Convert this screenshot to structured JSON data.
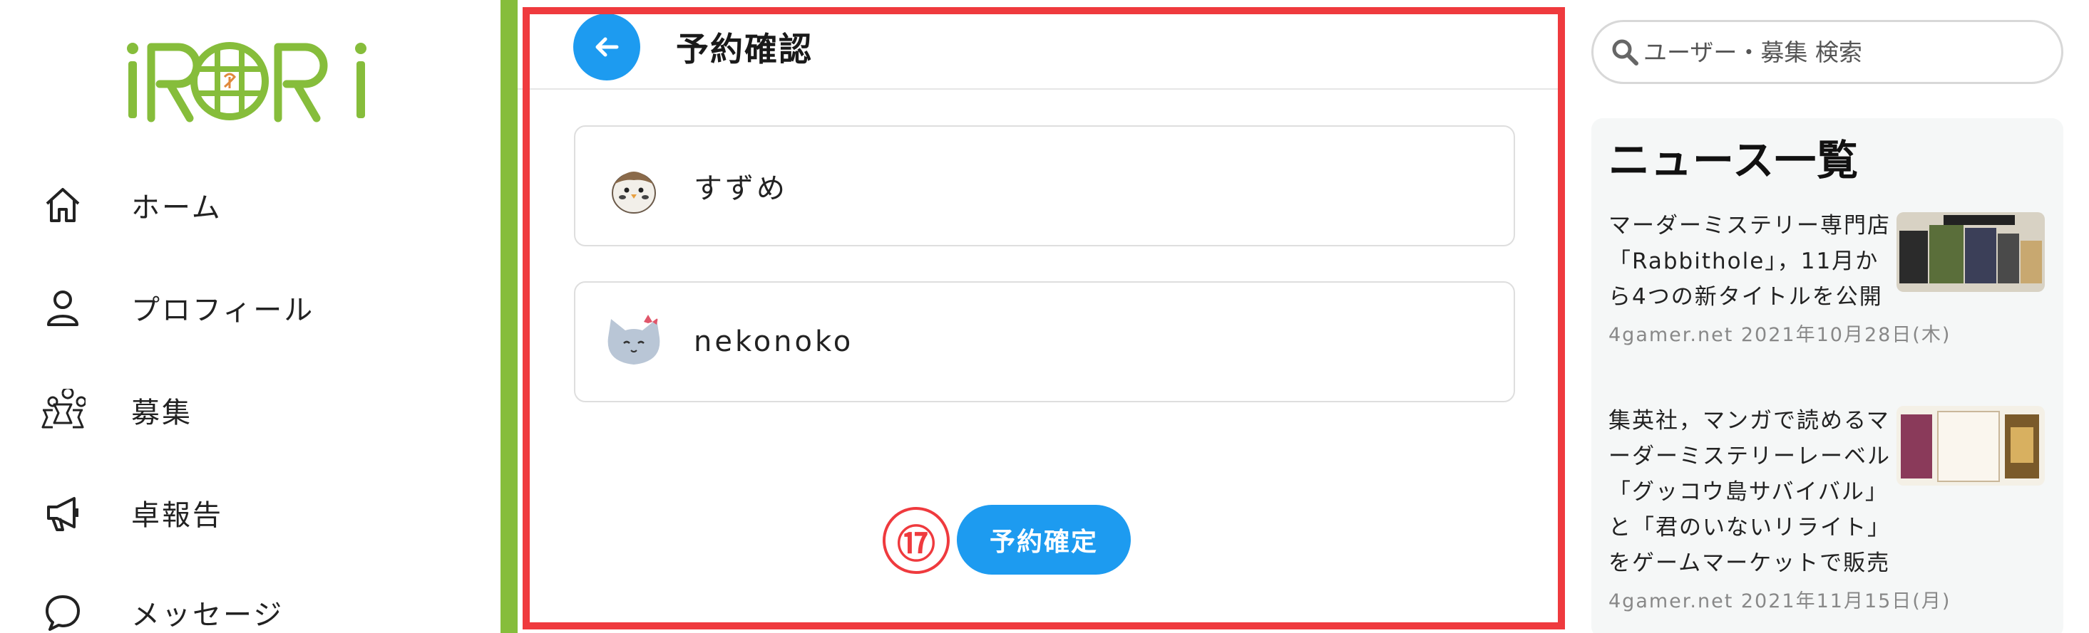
{
  "logo": {
    "text": "iRORi",
    "brand_color": "#86bd3b"
  },
  "nav": [
    {
      "label": "ホーム",
      "icon": "home-icon"
    },
    {
      "label": "プロフィール",
      "icon": "person-icon"
    },
    {
      "label": "募集",
      "icon": "meeple-group-icon"
    },
    {
      "label": "卓報告",
      "icon": "megaphone-icon"
    },
    {
      "label": "メッセージ",
      "icon": "chat-bubble-icon"
    }
  ],
  "main": {
    "title": "予約確認",
    "users": [
      {
        "name": "すずめ",
        "avatar": "sparrow-avatar"
      },
      {
        "name": "nekonoko",
        "avatar": "cat-avatar"
      }
    ],
    "step_number": "⑰",
    "confirm_label": "予約確定",
    "accent": "#1d9bf0",
    "highlight": "#ef3a3e"
  },
  "search": {
    "placeholder": "ユーザー・募集 検索"
  },
  "news": {
    "heading": "ニュース一覧",
    "items": [
      {
        "title": "マーダーミステリー専門店「Rabbithole」，11月から4つの新タイトルを公開",
        "meta": "4gamer.net 2021年10月28日(木)"
      },
      {
        "title": "集英社，マンガで読めるマーダーミステリーレーベル「グッコウ島サバイバル」と「君のいないリライト」をゲームマーケットで販売",
        "meta": "4gamer.net 2021年11月15日(月)"
      }
    ]
  }
}
